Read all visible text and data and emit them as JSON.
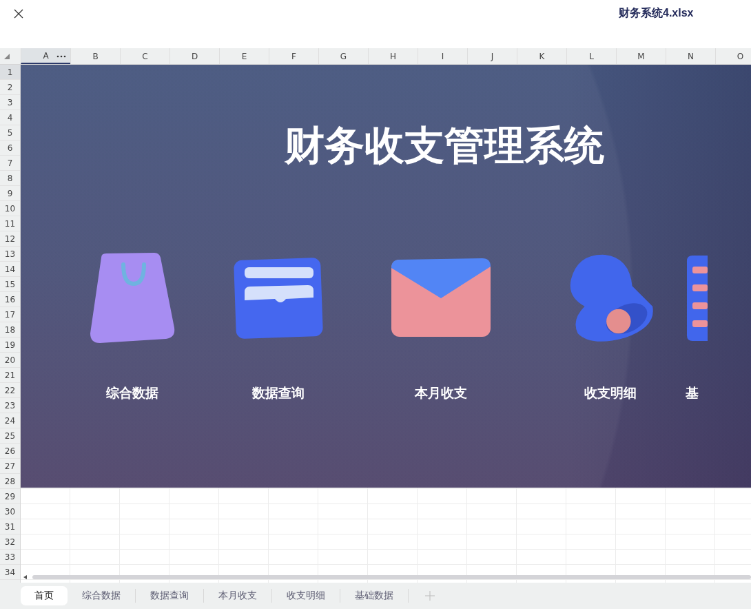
{
  "window": {
    "title": "财务系统4.xlsx"
  },
  "sheet": {
    "columns": [
      {
        "label": "A",
        "selected": true
      },
      {
        "label": "B",
        "selected": false
      },
      {
        "label": "C",
        "selected": false
      },
      {
        "label": "D",
        "selected": false
      },
      {
        "label": "E",
        "selected": false
      },
      {
        "label": "F",
        "selected": false
      },
      {
        "label": "G",
        "selected": false
      },
      {
        "label": "H",
        "selected": false
      },
      {
        "label": "I",
        "selected": false
      },
      {
        "label": "J",
        "selected": false
      },
      {
        "label": "K",
        "selected": false
      },
      {
        "label": "L",
        "selected": false
      },
      {
        "label": "M",
        "selected": false
      },
      {
        "label": "N",
        "selected": false
      },
      {
        "label": "O",
        "selected": false
      }
    ],
    "rows": [
      {
        "label": "1",
        "selected": true
      },
      {
        "label": "2",
        "selected": false
      },
      {
        "label": "3",
        "selected": false
      },
      {
        "label": "4",
        "selected": false
      },
      {
        "label": "5",
        "selected": false
      },
      {
        "label": "6",
        "selected": false
      },
      {
        "label": "7",
        "selected": false
      },
      {
        "label": "8",
        "selected": false
      },
      {
        "label": "9",
        "selected": false
      },
      {
        "label": "10",
        "selected": false
      },
      {
        "label": "11",
        "selected": false
      },
      {
        "label": "12",
        "selected": false
      },
      {
        "label": "13",
        "selected": false
      },
      {
        "label": "14",
        "selected": false
      },
      {
        "label": "15",
        "selected": false
      },
      {
        "label": "16",
        "selected": false
      },
      {
        "label": "17",
        "selected": false
      },
      {
        "label": "18",
        "selected": false
      },
      {
        "label": "19",
        "selected": false
      },
      {
        "label": "20",
        "selected": false
      },
      {
        "label": "21",
        "selected": false
      },
      {
        "label": "22",
        "selected": false
      },
      {
        "label": "23",
        "selected": false
      },
      {
        "label": "24",
        "selected": false
      },
      {
        "label": "25",
        "selected": false
      },
      {
        "label": "26",
        "selected": false
      },
      {
        "label": "27",
        "selected": false
      },
      {
        "label": "28",
        "selected": false
      },
      {
        "label": "29",
        "selected": false
      },
      {
        "label": "30",
        "selected": false
      },
      {
        "label": "31",
        "selected": false
      },
      {
        "label": "32",
        "selected": false
      },
      {
        "label": "33",
        "selected": false
      },
      {
        "label": "34",
        "selected": false
      }
    ],
    "banner": {
      "title": "财务收支管理系统",
      "items": [
        {
          "label": "综合数据"
        },
        {
          "label": "数据查询"
        },
        {
          "label": "本月收支"
        },
        {
          "label": "收支明细"
        },
        {
          "label": "基"
        }
      ]
    }
  },
  "sheet_tabs": [
    {
      "label": "首页",
      "selected": true
    },
    {
      "label": "综合数据",
      "selected": false
    },
    {
      "label": "数据查询",
      "selected": false
    },
    {
      "label": "本月收支",
      "selected": false
    },
    {
      "label": "收支明细",
      "selected": false
    },
    {
      "label": "基础数据",
      "selected": false
    }
  ]
}
